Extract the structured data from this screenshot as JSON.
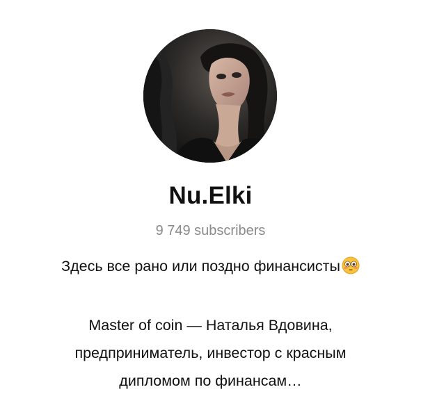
{
  "channel": {
    "name": "Nu.Elki",
    "subscribers": "9 749 subscribers",
    "tagline": "Здесь все рано или поздно финансисты",
    "tagline_emoji": "flushed-face-emoji",
    "description_lines": [
      "Master of coin — Наталья Вдовина,",
      "предприниматель, инвестор с красным",
      "дипломом по финансам…"
    ]
  },
  "colors": {
    "title": "#111111",
    "subtitle": "#8a8a8a",
    "background": "#ffffff",
    "emoji_face": "#f8c33a"
  }
}
